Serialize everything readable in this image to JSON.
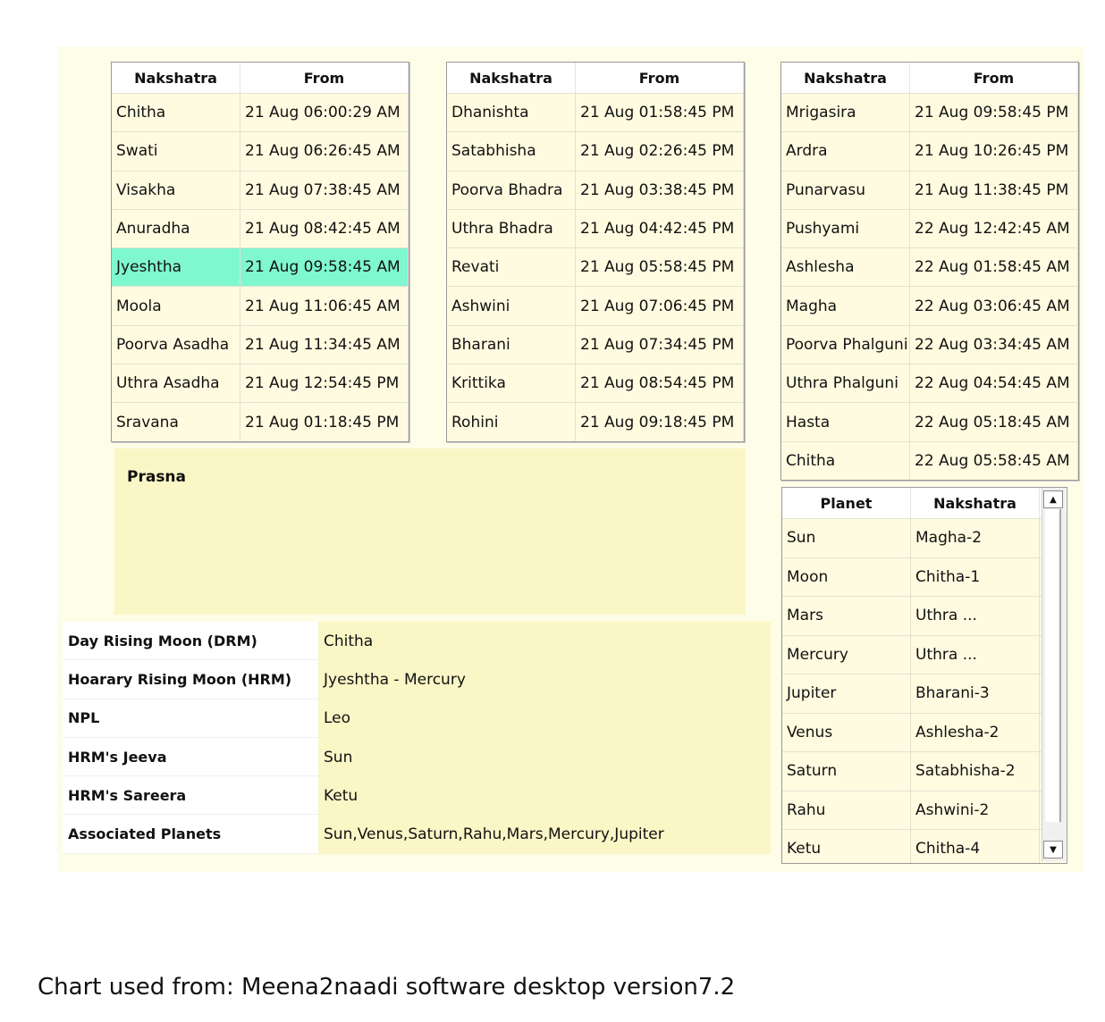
{
  "tables": {
    "t1": {
      "headers": [
        "Nakshatra",
        "From"
      ],
      "rows": [
        [
          "Chitha",
          "21 Aug 06:00:29 AM"
        ],
        [
          "Swati",
          "21 Aug 06:26:45 AM"
        ],
        [
          "Visakha",
          "21 Aug 07:38:45 AM"
        ],
        [
          "Anuradha",
          "21 Aug 08:42:45 AM"
        ],
        [
          "Jyeshtha",
          "21 Aug 09:58:45 AM"
        ],
        [
          "Moola",
          "21 Aug 11:06:45 AM"
        ],
        [
          "Poorva Asadha",
          "21 Aug 11:34:45 AM"
        ],
        [
          "Uthra Asadha",
          "21 Aug 12:54:45 PM"
        ],
        [
          "Sravana",
          "21 Aug 01:18:45 PM"
        ]
      ]
    },
    "t2": {
      "headers": [
        "Nakshatra",
        "From"
      ],
      "rows": [
        [
          "Dhanishta",
          "21 Aug 01:58:45 PM"
        ],
        [
          "Satabhisha",
          "21 Aug 02:26:45 PM"
        ],
        [
          "Poorva Bhadra",
          "21 Aug 03:38:45 PM"
        ],
        [
          "Uthra Bhadra",
          "21 Aug 04:42:45 PM"
        ],
        [
          "Revati",
          "21 Aug 05:58:45 PM"
        ],
        [
          "Ashwini",
          "21 Aug 07:06:45 PM"
        ],
        [
          "Bharani",
          "21 Aug 07:34:45 PM"
        ],
        [
          "Krittika",
          "21 Aug 08:54:45 PM"
        ],
        [
          "Rohini",
          "21 Aug 09:18:45 PM"
        ]
      ]
    },
    "t3": {
      "headers": [
        "Nakshatra",
        "From"
      ],
      "rows": [
        [
          "Mrigasira",
          "21 Aug 09:58:45 PM"
        ],
        [
          "Ardra",
          "21 Aug 10:26:45 PM"
        ],
        [
          "Punarvasu",
          "21 Aug 11:38:45 PM"
        ],
        [
          "Pushyami",
          "22 Aug 12:42:45 AM"
        ],
        [
          "Ashlesha",
          "22 Aug 01:58:45 AM"
        ],
        [
          "Magha",
          "22 Aug 03:06:45 AM"
        ],
        [
          "Poorva Phalguni",
          "22 Aug 03:34:45 AM"
        ],
        [
          "Uthra Phalguni",
          "22 Aug 04:54:45 AM"
        ],
        [
          "Hasta",
          "22 Aug 05:18:45 AM"
        ],
        [
          "Chitha",
          "22 Aug 05:58:45 AM"
        ]
      ]
    }
  },
  "prasna": {
    "title": "Prasna"
  },
  "info": [
    {
      "label": "Day Rising Moon (DRM)",
      "value": "Chitha"
    },
    {
      "label": "Hoarary Rising Moon (HRM)",
      "value": "Jyeshtha - Mercury"
    },
    {
      "label": "NPL",
      "value": "Leo"
    },
    {
      "label": "HRM's Jeeva",
      "value": "Sun"
    },
    {
      "label": "HRM's Sareera",
      "value": "Ketu"
    },
    {
      "label": "Associated Planets",
      "value": "Sun,Venus,Saturn,Rahu,Mars,Mercury,Jupiter"
    }
  ],
  "planets": {
    "headers": [
      "Planet",
      "Nakshatra"
    ],
    "rows": [
      [
        "Sun",
        "Magha-2"
      ],
      [
        "Moon",
        "Chitha-1"
      ],
      [
        "Mars",
        "Uthra ..."
      ],
      [
        "Mercury",
        "Uthra ..."
      ],
      [
        "Jupiter",
        "Bharani-3"
      ],
      [
        "Venus",
        "Ashlesha-2"
      ],
      [
        "Saturn",
        "Satabhisha-2"
      ],
      [
        "Rahu",
        "Ashwini-2"
      ],
      [
        "Ketu",
        "Chitha-4"
      ]
    ]
  },
  "caption": "Chart used from: Meena2naadi software desktop version7.2"
}
